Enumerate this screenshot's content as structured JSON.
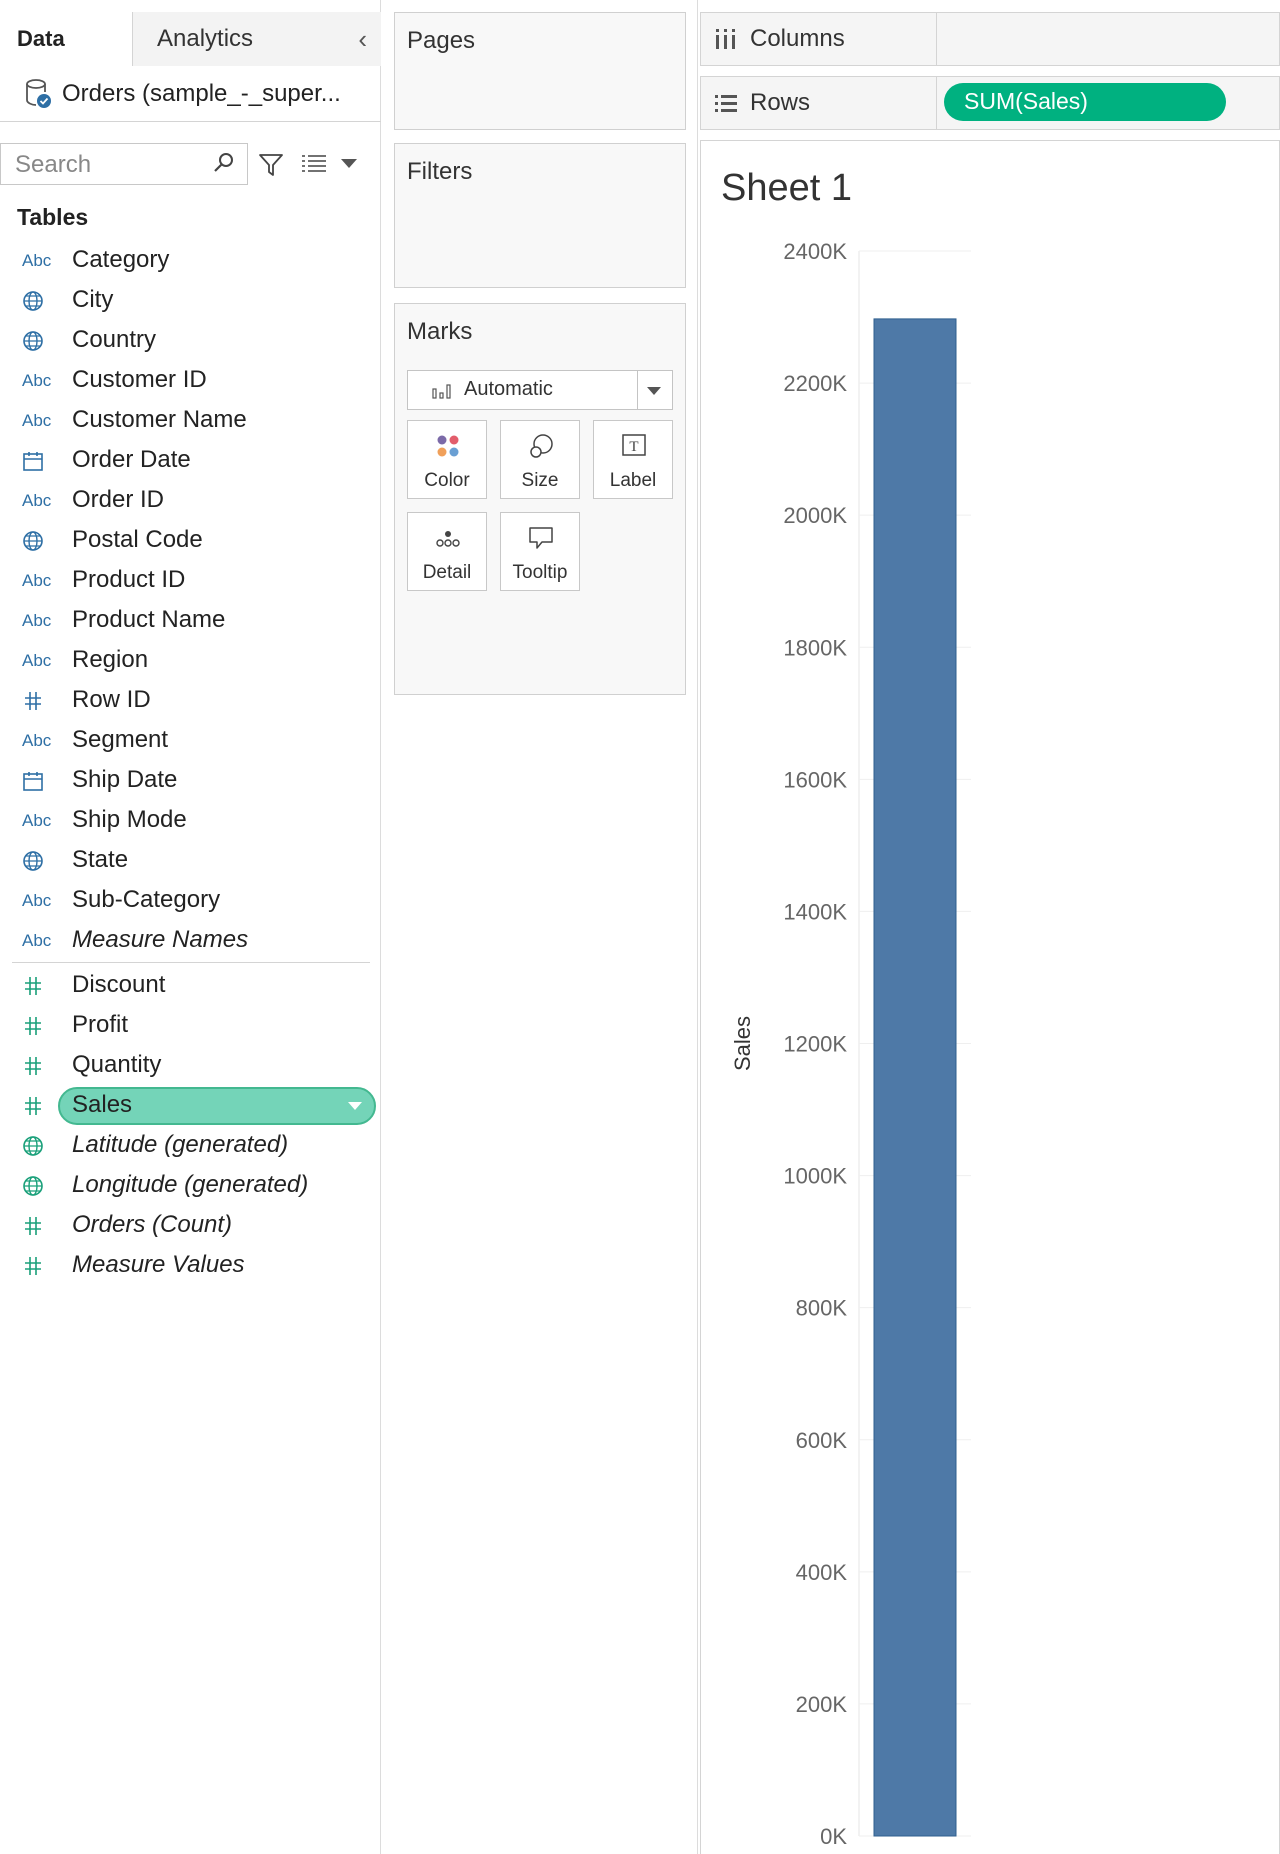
{
  "data_pane": {
    "tab_data": "Data",
    "tab_analytics": "Analytics",
    "datasource_name": "Orders (sample_-_super...",
    "search_placeholder": "Search",
    "tables_heading": "Tables",
    "dimensions": [
      {
        "label": "Category",
        "type": "abc"
      },
      {
        "label": "City",
        "type": "geo"
      },
      {
        "label": "Country",
        "type": "geo"
      },
      {
        "label": "Customer ID",
        "type": "abc"
      },
      {
        "label": "Customer Name",
        "type": "abc"
      },
      {
        "label": "Order Date",
        "type": "date"
      },
      {
        "label": "Order ID",
        "type": "abc"
      },
      {
        "label": "Postal Code",
        "type": "geo"
      },
      {
        "label": "Product ID",
        "type": "abc"
      },
      {
        "label": "Product Name",
        "type": "abc"
      },
      {
        "label": "Region",
        "type": "abc"
      },
      {
        "label": "Row ID",
        "type": "num"
      },
      {
        "label": "Segment",
        "type": "abc"
      },
      {
        "label": "Ship Date",
        "type": "date"
      },
      {
        "label": "Ship Mode",
        "type": "abc"
      },
      {
        "label": "State",
        "type": "geo"
      },
      {
        "label": "Sub-Category",
        "type": "abc"
      },
      {
        "label": "Measure Names",
        "type": "abc",
        "italic": true
      }
    ],
    "measures": [
      {
        "label": "Discount",
        "type": "num"
      },
      {
        "label": "Profit",
        "type": "num"
      },
      {
        "label": "Quantity",
        "type": "num"
      },
      {
        "label": "Sales",
        "type": "num",
        "selected": true
      },
      {
        "label": "Latitude (generated)",
        "type": "geo",
        "italic": true
      },
      {
        "label": "Longitude (generated)",
        "type": "geo",
        "italic": true
      },
      {
        "label": "Orders (Count)",
        "type": "num",
        "italic": true
      },
      {
        "label": "Measure Values",
        "type": "num",
        "italic": true
      }
    ],
    "icon_names": {
      "abc": "Abc",
      "geo": "globe-icon",
      "date": "calendar-icon",
      "num": "hash-icon"
    }
  },
  "cards": {
    "pages_title": "Pages",
    "filters_title": "Filters",
    "marks_title": "Marks",
    "mark_type": "Automatic",
    "mark_buttons": [
      {
        "label": "Color",
        "icon": "color-icon"
      },
      {
        "label": "Size",
        "icon": "size-icon"
      },
      {
        "label": "Label",
        "icon": "label-icon"
      },
      {
        "label": "Detail",
        "icon": "detail-icon"
      },
      {
        "label": "Tooltip",
        "icon": "tooltip-icon"
      }
    ]
  },
  "shelves": {
    "columns_label": "Columns",
    "rows_label": "Rows",
    "rows_pill": "SUM(Sales)"
  },
  "view": {
    "sheet_title": "Sheet 1"
  },
  "colors": {
    "bar": "#4e79a7",
    "measure_pill": "#00b180",
    "selected_field": "#74d4b8",
    "dimension_icon": "#2e6fa5",
    "measure_icon": "#1aa07a"
  },
  "chart_data": {
    "type": "bar",
    "categories": [
      ""
    ],
    "values": [
      2297200
    ],
    "title": "Sheet 1",
    "xlabel": "",
    "ylabel": "Sales",
    "ylim": [
      0,
      2400000
    ],
    "yticks": [
      "0K",
      "200K",
      "400K",
      "600K",
      "800K",
      "1000K",
      "1200K",
      "1400K",
      "1600K",
      "1800K",
      "2000K",
      "2200K",
      "2400K"
    ],
    "ytick_values": [
      0,
      200000,
      400000,
      600000,
      800000,
      1000000,
      1200000,
      1400000,
      1600000,
      1800000,
      2000000,
      2200000,
      2400000
    ],
    "grid": true
  }
}
